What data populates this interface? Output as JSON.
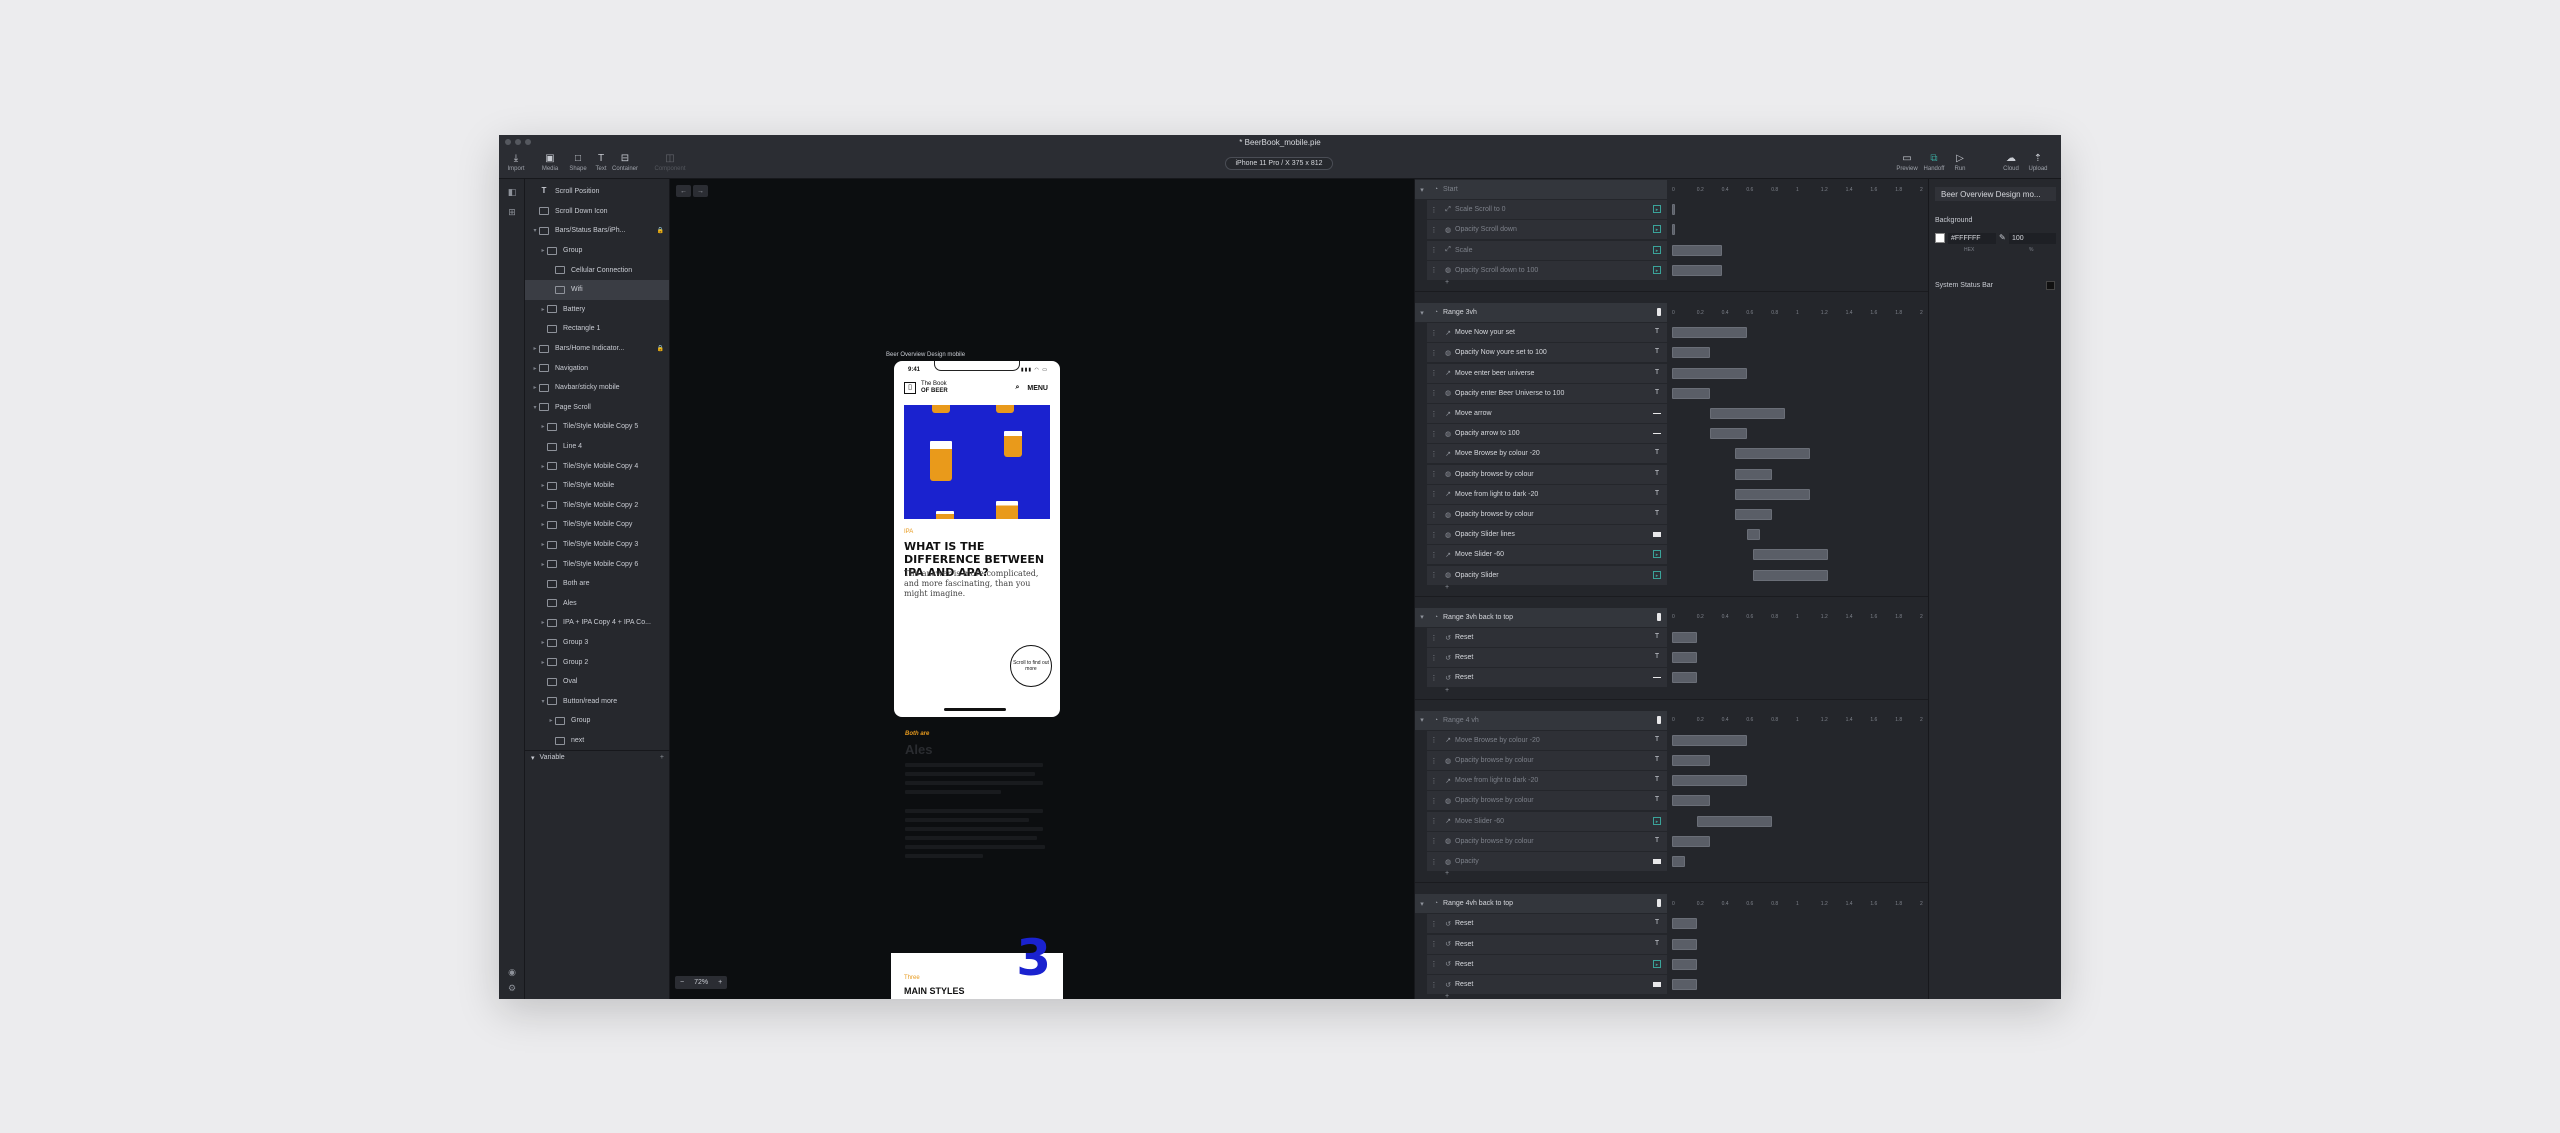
{
  "window": {
    "title": "* BeerBook_mobile.pie"
  },
  "toolbar": {
    "import": "Import",
    "media": "Media",
    "shape": "Shape",
    "text": "Text",
    "container": "Container",
    "component": "Component",
    "device": "iPhone 11 Pro / X  375 x 812",
    "preview": "Preview",
    "handoff": "Handoff",
    "run": "Run",
    "cloud": "Cloud",
    "upload": "Upload"
  },
  "layers": {
    "items": [
      {
        "label": "Scroll Position",
        "type": "T"
      },
      {
        "label": "Scroll Down Icon",
        "type": "img"
      },
      {
        "label": "Bars/Status Bars/iPh...",
        "type": "comp",
        "lock": true
      },
      {
        "label": "Group",
        "type": "grp"
      },
      {
        "label": "Cellular Connection",
        "type": "img"
      },
      {
        "label": "Wifi",
        "type": "img"
      },
      {
        "label": "Battery",
        "type": "grp"
      },
      {
        "label": "Rectangle 1",
        "type": "rect"
      },
      {
        "label": "Bars/Home Indicator...",
        "type": "comp",
        "lock": true
      },
      {
        "label": "Navigation",
        "type": "grp"
      },
      {
        "label": "Navbar/sticky mobile",
        "type": "grp"
      },
      {
        "label": "Page Scroll",
        "type": "grp"
      },
      {
        "label": "Tile/Style Mobile Copy 5",
        "type": "grp"
      },
      {
        "label": "Line 4",
        "type": "img"
      },
      {
        "label": "Tile/Style Mobile Copy 4",
        "type": "grp"
      },
      {
        "label": "Tile/Style Mobile",
        "type": "grp"
      },
      {
        "label": "Tile/Style Mobile Copy 2",
        "type": "grp"
      },
      {
        "label": "Tile/Style Mobile Copy",
        "type": "grp"
      },
      {
        "label": "Tile/Style Mobile Copy 3",
        "type": "grp"
      },
      {
        "label": "Tile/Style Mobile Copy 6",
        "type": "grp"
      },
      {
        "label": "Both are",
        "type": "img"
      },
      {
        "label": "Ales",
        "type": "img"
      },
      {
        "label": "IPA + IPA Copy 4 + IPA Co...",
        "type": "grp"
      },
      {
        "label": "Group 3",
        "type": "grp"
      },
      {
        "label": "Group 2",
        "type": "grp"
      },
      {
        "label": "Oval",
        "type": "img"
      },
      {
        "label": "Button/read more",
        "type": "grp"
      },
      {
        "label": "Group",
        "type": "grp"
      },
      {
        "label": "next",
        "type": "img"
      }
    ],
    "variable_label": "Variable"
  },
  "canvas": {
    "frame_label": "Beer Overview Design mobile",
    "zoom": "72%",
    "phone": {
      "time": "9:41",
      "brand_line1": "The Book",
      "brand_line2": "OF BEER",
      "menu": "MENU",
      "eyebrow": "IPA",
      "headline": "WHAT IS THE DIFFERENCE BETWEEN IPA AND APA?",
      "subtext": "The answer is more complicated, and more fascinating, than you might imagine.",
      "stamp_text": "Scroll to find out more"
    },
    "below_eyebrow": "Both are",
    "below_title": "Ales",
    "card": {
      "number": "3",
      "eyebrow": "Three",
      "title": "MAIN STYLES"
    }
  },
  "timeline": {
    "ruler_ticks": [
      "0",
      "0.2",
      "0.4",
      "0.6",
      "0.8",
      "1",
      "1.2",
      "1.4",
      "1.6",
      "1.8",
      "2"
    ],
    "sections": [
      {
        "title": "Start",
        "dim": true,
        "rows": [
          {
            "label": "Scale Scroll to 0"
          },
          {
            "label": "Opacity Scroll down"
          },
          {
            "label": "Scale"
          },
          {
            "label": "Opacity Scroll down to 100"
          }
        ]
      },
      {
        "title": "Range 3vh",
        "dim": false,
        "rows": [
          {
            "label": "Move Now your set"
          },
          {
            "label": "Opacity Now youre set to 100"
          },
          {
            "label": "Move enter beer universe"
          },
          {
            "label": "Opacity enter Beer Universe to 100"
          },
          {
            "label": "Move arrow"
          },
          {
            "label": "Opacity arrow to 100"
          },
          {
            "label": "Move Browse by colour -20"
          },
          {
            "label": "Opacity browse by colour"
          },
          {
            "label": "Move from light to dark -20"
          },
          {
            "label": "Opacity browse by colour"
          },
          {
            "label": "Opacity Slider lines"
          },
          {
            "label": "Move Slider -60"
          },
          {
            "label": "Opacity Slider"
          }
        ]
      },
      {
        "title": "Range 3vh back to top",
        "dim": false,
        "rows": [
          {
            "label": "Reset"
          },
          {
            "label": "Reset"
          },
          {
            "label": "Reset"
          }
        ]
      },
      {
        "title": "Range 4 vh",
        "dim": true,
        "rows": [
          {
            "label": "Move Browse by colour -20"
          },
          {
            "label": "Opacity browse by colour"
          },
          {
            "label": "Move from light to dark -20"
          },
          {
            "label": "Opacity browse by colour"
          },
          {
            "label": "Move Slider -60"
          },
          {
            "label": "Opacity browse by colour"
          },
          {
            "label": "Opacity"
          }
        ]
      },
      {
        "title": "Range 4vh back to top",
        "dim": false,
        "rows": [
          {
            "label": "Reset"
          },
          {
            "label": "Reset"
          },
          {
            "label": "Reset"
          },
          {
            "label": "Reset"
          }
        ]
      }
    ]
  },
  "inspector": {
    "title": "Beer Overview Design mo...",
    "background_label": "Background",
    "hex": "#FFFFFF",
    "opacity": "100",
    "hex_caption": "HEX",
    "opacity_caption": "%",
    "system_status_bar": "System Status Bar"
  },
  "colors": {
    "accent_teal": "#3aa39a",
    "brand_blue": "#1a22cf",
    "brand_orange": "#e79a1e"
  }
}
